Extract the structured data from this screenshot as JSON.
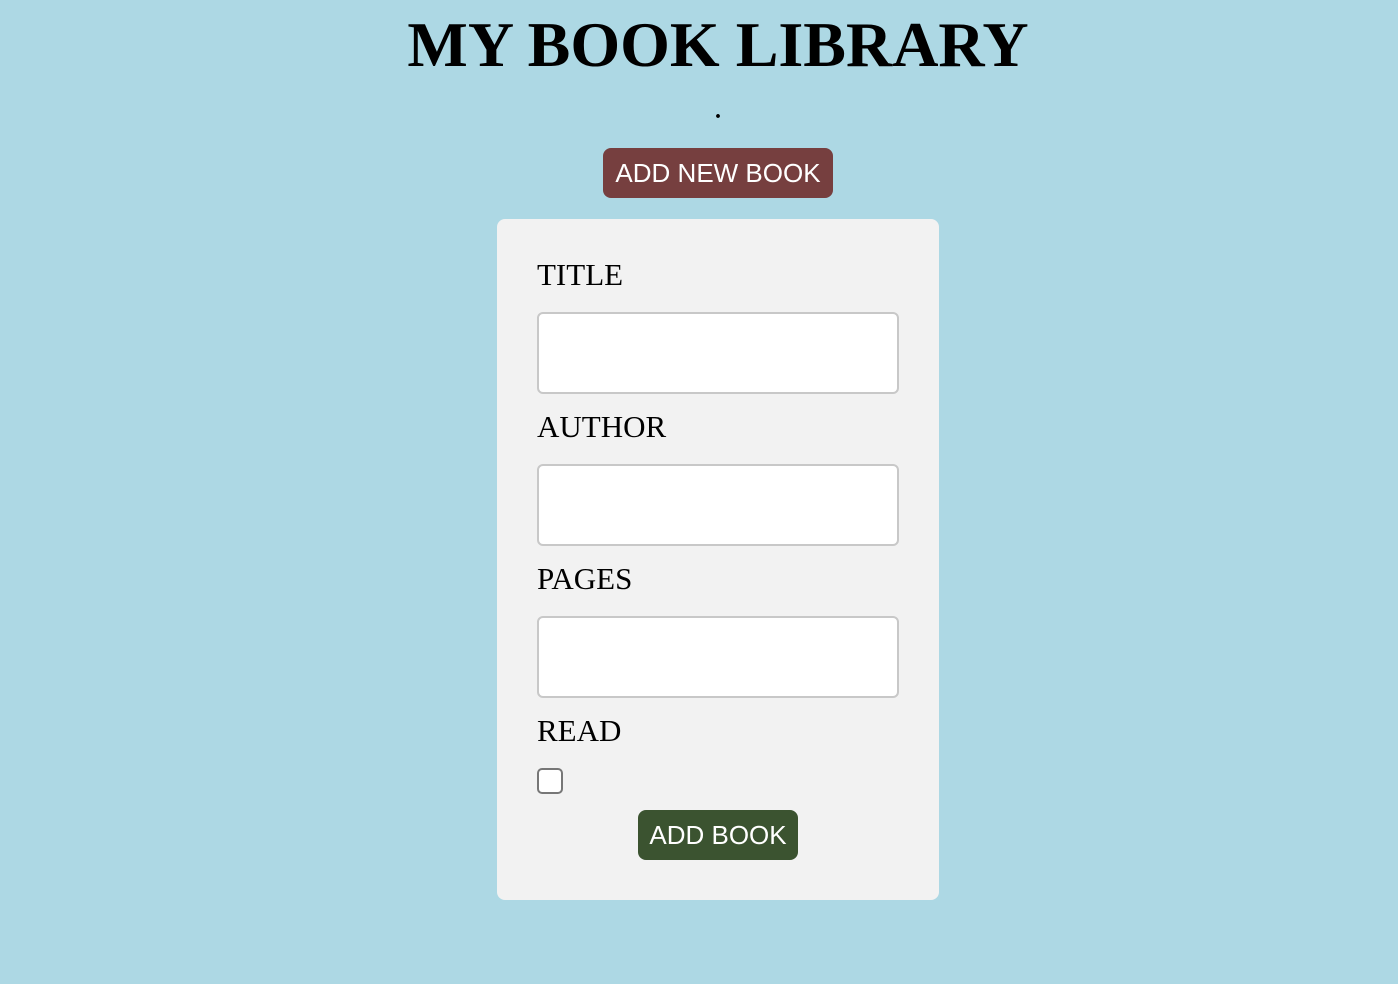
{
  "header": {
    "title": "MY BOOK LIBRARY",
    "subtitle": "."
  },
  "toolbar": {
    "add_new_label": "ADD NEW BOOK"
  },
  "form": {
    "title_label": "TITLE",
    "title_value": "",
    "author_label": "AUTHOR",
    "author_value": "",
    "pages_label": "PAGES",
    "pages_value": "",
    "read_label": "READ",
    "read_checked": false,
    "submit_label": "ADD BOOK"
  },
  "colors": {
    "background": "#add8e4",
    "add_new_button": "#763f3f",
    "submit_button": "#3b5330",
    "card": "#f2f2f2"
  }
}
